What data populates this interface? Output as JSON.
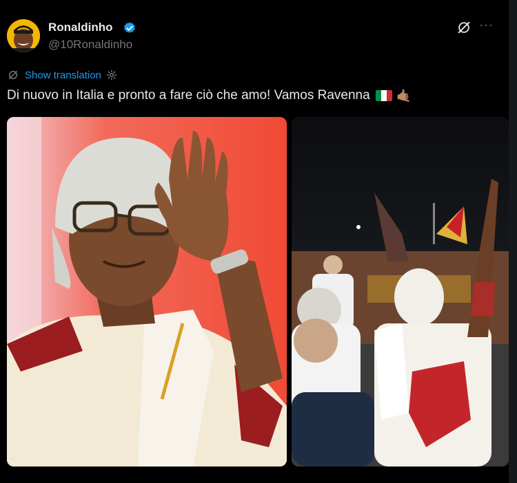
{
  "author": {
    "name": "Ronaldinho",
    "handle": "@10Ronaldinho",
    "avatar_icon": "avatar-photo",
    "verified_icon": "verified-badge-icon"
  },
  "actions": {
    "grok_icon": "grok-icon",
    "more_label": "···"
  },
  "translation": {
    "label": "Show translation"
  },
  "tweet": {
    "text": "Di nuovo in Italia e pronto a fare ciò che amo! Vamos Ravenna",
    "emoji_flag": "italy-flag",
    "emoji_hand": "🤙🏽"
  },
  "media": [
    {
      "name": "photo-waving",
      "description_icon": "photo"
    },
    {
      "name": "photo-crowd",
      "description_icon": "photo"
    }
  ],
  "colors": {
    "background": "#000000",
    "text": "#e7e9ea",
    "muted": "#71767b",
    "accent": "#1d9bf0"
  }
}
